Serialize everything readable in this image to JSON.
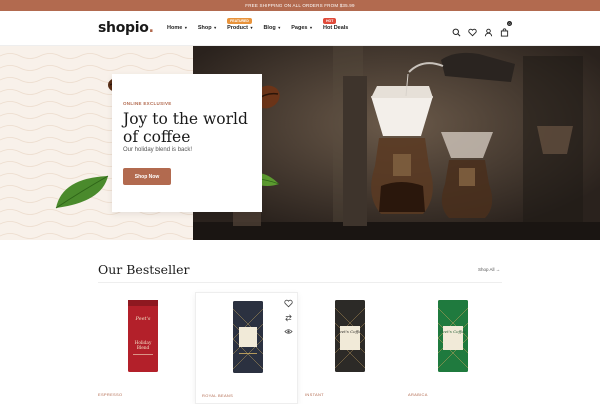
{
  "topbar": {
    "text": "FREE SHIPPING ON ALL ORDERS FROM $35.99"
  },
  "header": {
    "logo": "shopio",
    "logo_dot": ".",
    "nav": [
      {
        "label": "Home",
        "caret": "▾",
        "badge": ""
      },
      {
        "label": "Shop",
        "caret": "▾",
        "badge": ""
      },
      {
        "label": "Product",
        "caret": "▾",
        "badge": "FEATURED",
        "badge_color": "#e8933b"
      },
      {
        "label": "Blog",
        "caret": "▾",
        "badge": ""
      },
      {
        "label": "Pages",
        "caret": "▾",
        "badge": ""
      },
      {
        "label": "Hot Deals",
        "caret": "",
        "badge": "HOT",
        "badge_color": "#e04a3a"
      }
    ],
    "icons": [
      "search-icon",
      "heart-icon",
      "user-icon",
      "cart-icon"
    ],
    "cart_count": "0"
  },
  "hero": {
    "kicker": "ONLINE EXCLUSIVE",
    "title": "Joy to the world of coffee",
    "subtitle": "Our holiday blend is back!",
    "button": "Shop Now"
  },
  "bestseller": {
    "title": "Our Bestseller",
    "shop_all": "Shop All",
    "products": [
      {
        "category": "ESPRESSO",
        "bag_color": "#b3202a",
        "bag_label": "Holiday Blend"
      },
      {
        "category": "ROYAL BEANS",
        "bag_color": "#2b3140",
        "bag_label": "Peet's Coffee"
      },
      {
        "category": "INSTANT",
        "bag_color": "#2c2a27",
        "bag_label": "Peet's Coffee"
      },
      {
        "category": "ARABICA",
        "bag_color": "#1f7a3e",
        "bag_label": "Peet's Coffee"
      }
    ]
  },
  "colors": {
    "accent": "#b26a4f",
    "dark": "#1a1a1a"
  }
}
